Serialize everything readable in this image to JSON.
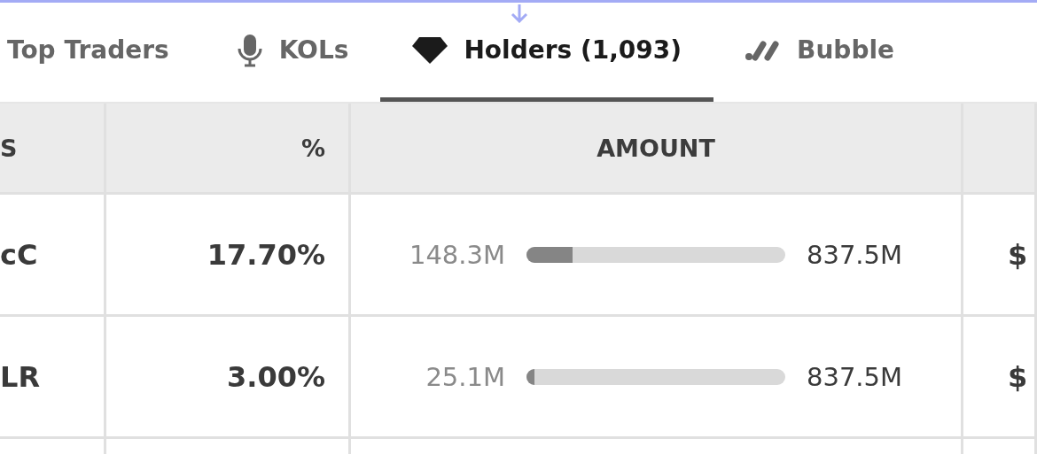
{
  "tabs": [
    {
      "label": "Top Traders",
      "selected": false
    },
    {
      "label": "KOLs",
      "selected": false
    },
    {
      "label": "Holders (1,093)",
      "selected": true
    },
    {
      "label": "Bubble",
      "selected": false
    }
  ],
  "table": {
    "columns": [
      "S",
      "%",
      "AMOUNT"
    ],
    "rows": [
      {
        "column_1": "cC",
        "percent": "17.70%",
        "amount": "148.3M",
        "level": 0.177,
        "total": "837.5M",
        "column_4": "$"
      },
      {
        "column_1": "LR",
        "percent": "3.00%",
        "amount": "25.1M",
        "level": 0.03,
        "total": "837.5M",
        "column_4": "$"
      }
    ]
  }
}
